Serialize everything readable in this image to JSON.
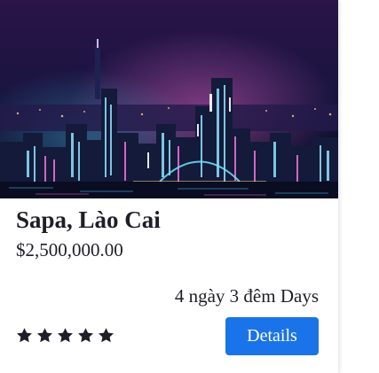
{
  "card": {
    "image_alt": "Sapa night city skyline",
    "title": "Sapa, Lào Cai",
    "price": "$2,500,000.00",
    "duration": "4 ngày 3 đêm Days",
    "rating": 5,
    "details_label": "Details"
  },
  "colors": {
    "button": "#1a73e8",
    "text": "#1e1e28",
    "star": "#1e1e28"
  },
  "icons": [
    "star-icon"
  ]
}
